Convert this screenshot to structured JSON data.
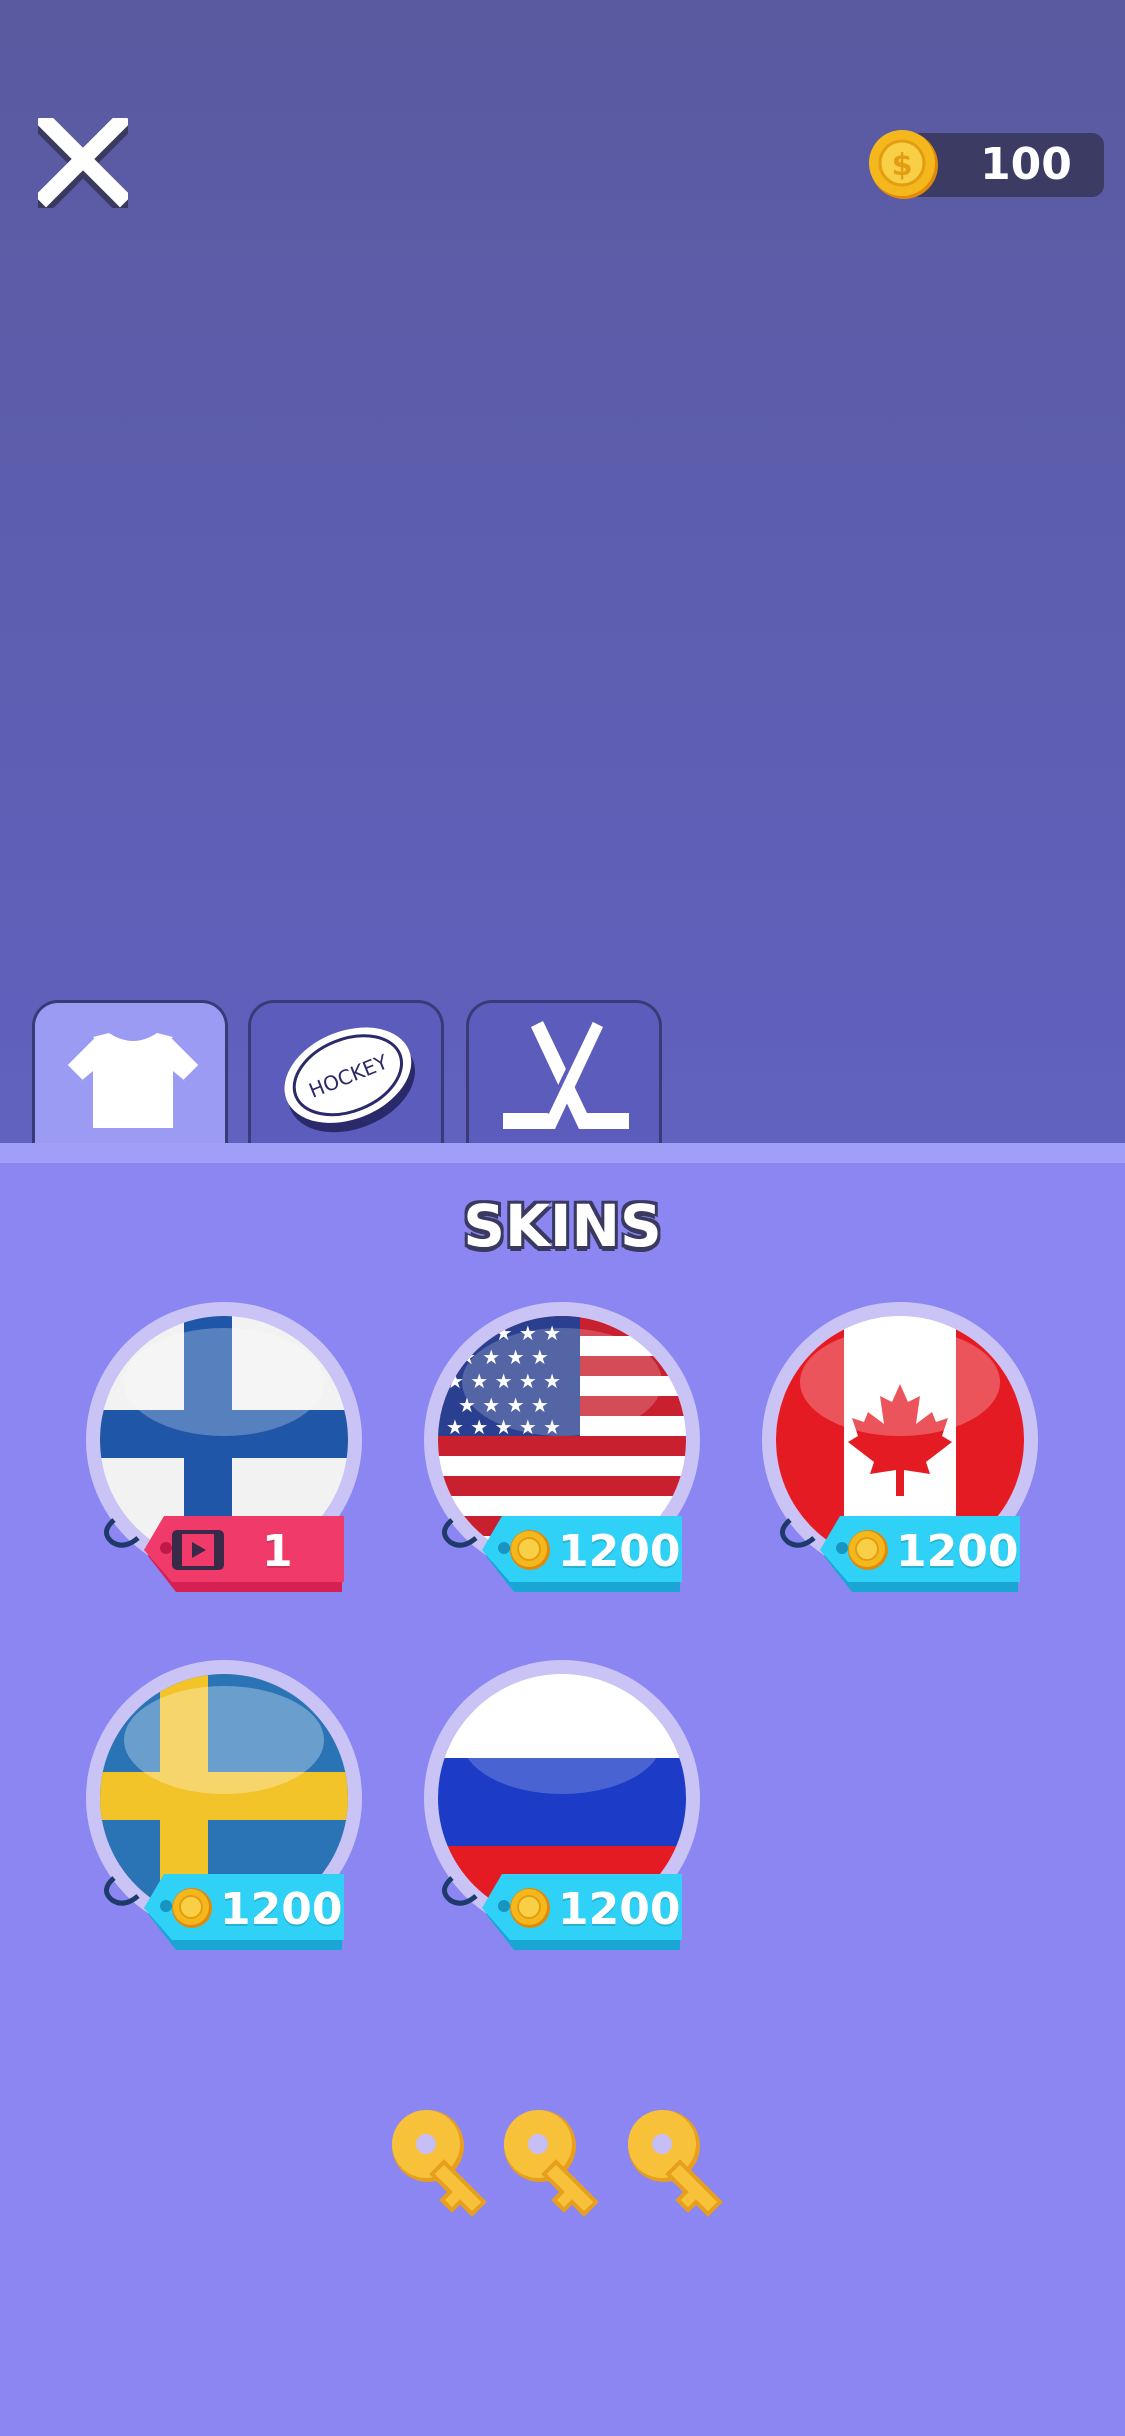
{
  "header": {
    "close_icon": "close-x-icon",
    "coins": "100"
  },
  "tabs": [
    {
      "id": "shirts",
      "icon": "tshirt-icon",
      "active": true
    },
    {
      "id": "pucks",
      "icon": "hockey-puck-icon",
      "puck_label": "HOCKEY",
      "active": false
    },
    {
      "id": "sticks",
      "icon": "hockey-sticks-icon",
      "active": false
    }
  ],
  "panel": {
    "title": "SKINS",
    "skins": [
      {
        "flag": "finland",
        "price_type": "video",
        "price": "1",
        "tag_color": "#e8265a"
      },
      {
        "flag": "usa",
        "price_type": "coins",
        "price": "1200",
        "tag_color": "#28c6ef"
      },
      {
        "flag": "canada",
        "price_type": "coins",
        "price": "1200",
        "tag_color": "#28c6ef"
      },
      {
        "flag": "sweden",
        "price_type": "coins",
        "price": "1200",
        "tag_color": "#28c6ef"
      },
      {
        "flag": "russia",
        "price_type": "coins",
        "price": "1200",
        "tag_color": "#28c6ef"
      }
    ],
    "keys_count": 3
  },
  "colors": {
    "background_top": "#5a5aa0",
    "background_bottom": "#6c6ce4",
    "panel": "#8b86f2",
    "coin_gold": "#f5b81c",
    "key_gold": "#f7c23a"
  }
}
